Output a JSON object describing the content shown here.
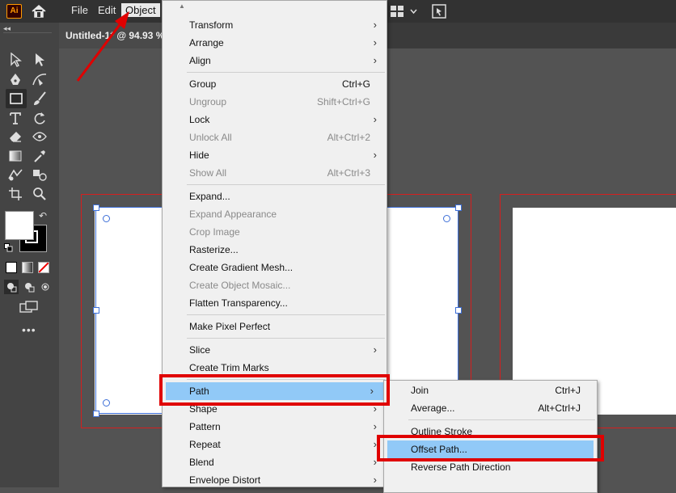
{
  "app": {
    "logo_text": "Ai"
  },
  "menubar": {
    "items": [
      "File",
      "Edit",
      "Object"
    ]
  },
  "document": {
    "tab_title": "Untitled-1* @ 94.93 %"
  },
  "object_menu": {
    "items": [
      {
        "label": "Transform",
        "submenu": true
      },
      {
        "label": "Arrange",
        "submenu": true
      },
      {
        "label": "Align",
        "submenu": true
      },
      {
        "sep": true
      },
      {
        "label": "Group",
        "shortcut": "Ctrl+G"
      },
      {
        "label": "Ungroup",
        "shortcut": "Shift+Ctrl+G",
        "disabled": true
      },
      {
        "label": "Lock",
        "submenu": true
      },
      {
        "label": "Unlock All",
        "shortcut": "Alt+Ctrl+2",
        "disabled": true
      },
      {
        "label": "Hide",
        "submenu": true
      },
      {
        "label": "Show All",
        "shortcut": "Alt+Ctrl+3",
        "disabled": true
      },
      {
        "sep": true
      },
      {
        "label": "Expand..."
      },
      {
        "label": "Expand Appearance",
        "disabled": true
      },
      {
        "label": "Crop Image",
        "disabled": true
      },
      {
        "label": "Rasterize..."
      },
      {
        "label": "Create Gradient Mesh..."
      },
      {
        "label": "Create Object Mosaic...",
        "disabled": true
      },
      {
        "label": "Flatten Transparency..."
      },
      {
        "sep": true
      },
      {
        "label": "Make Pixel Perfect"
      },
      {
        "sep": true
      },
      {
        "label": "Slice",
        "submenu": true
      },
      {
        "label": "Create Trim Marks"
      },
      {
        "sep": true
      },
      {
        "label": "Path",
        "submenu": true,
        "highlighted": true
      },
      {
        "label": "Shape",
        "submenu": true
      },
      {
        "label": "Pattern",
        "submenu": true
      },
      {
        "label": "Repeat",
        "submenu": true
      },
      {
        "label": "Blend",
        "submenu": true
      },
      {
        "label": "Envelope Distort",
        "submenu": true
      }
    ]
  },
  "path_submenu": {
    "items": [
      {
        "label": "Join",
        "shortcut": "Ctrl+J"
      },
      {
        "label": "Average...",
        "shortcut": "Alt+Ctrl+J"
      },
      {
        "sep": true
      },
      {
        "label": "Outline Stroke"
      },
      {
        "label": "Offset Path...",
        "highlighted": true
      },
      {
        "label": "Reverse Path Direction"
      }
    ]
  },
  "colors": {
    "highlight": "#91c9f7",
    "callout": "#e00000",
    "artboard_outline": "#d61e1e",
    "selection": "#3d6fd8"
  }
}
